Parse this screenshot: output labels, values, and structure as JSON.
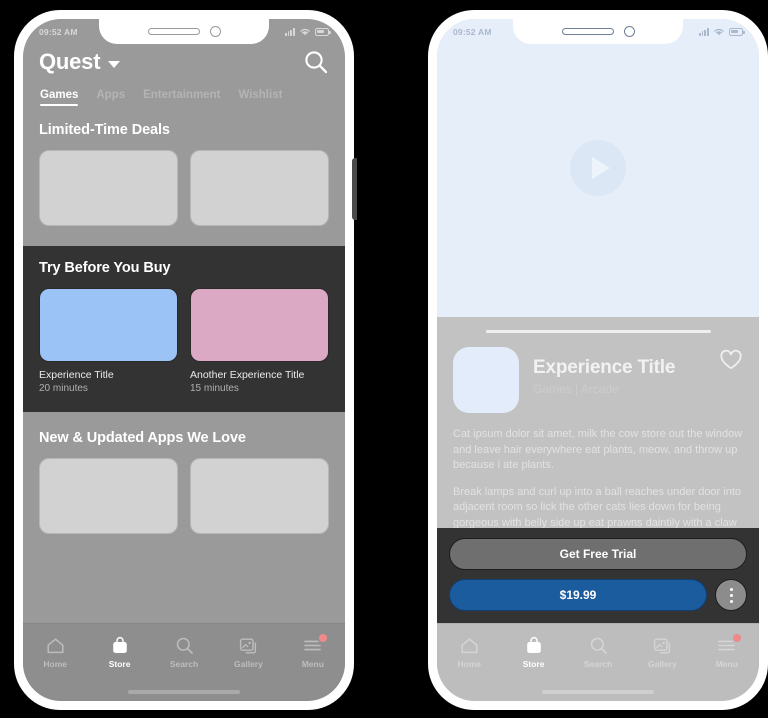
{
  "left_phone": {
    "status_bar": {
      "time": "09:52 AM",
      "icons": [
        "signal-icon",
        "wifi-icon",
        "battery-icon"
      ]
    },
    "header": {
      "brand": "Quest",
      "brand_chevron_icon": "chevron-down-icon",
      "search_icon": "search-icon"
    },
    "tabs": [
      {
        "label": "Games",
        "active": true
      },
      {
        "label": "Apps",
        "active": false
      },
      {
        "label": "Entertainment",
        "active": false
      },
      {
        "label": "Wishlist",
        "active": false
      }
    ],
    "sections": [
      {
        "title": "Limited-Time Deals",
        "placeholders": 2
      },
      {
        "title": "New & Updated Apps We Love",
        "placeholders": 2
      }
    ],
    "try_before_you_buy": {
      "title": "Try Before You Buy",
      "items": [
        {
          "name": "Experience Title",
          "duration": "20 minutes",
          "color": "#9cc3f5"
        },
        {
          "name": "Another Experience Title",
          "duration": "15 minutes",
          "color": "#dba9c4"
        }
      ]
    }
  },
  "right_phone": {
    "status_bar": {
      "time": "09:52 AM",
      "icons": [
        "signal-icon",
        "wifi-icon",
        "battery-icon"
      ]
    },
    "video": {
      "play_icon": "play-icon"
    },
    "detail": {
      "app_title": "Experience Title",
      "app_subtitle": "Games | Arcade",
      "favorite_icon": "heart-icon",
      "paragraphs": [
        "Cat ipsum dolor sit amet, milk the cow store out the window and leave hair everywhere eat plants, meow, and throw up because i ate plants.",
        "Break lamps and curl up into a ball reaches under door into adjacent room so lick the other cats lies down for being gorgeous with belly side up eat prawns daintily with a claw then lick paw wash down prawns with a lap"
      ]
    },
    "actions": {
      "trial_label": "Get Free Trial",
      "price_label": "$19.99",
      "more_icon": "more-vertical-icon"
    }
  },
  "bottom_nav": {
    "items": [
      {
        "label": "Home",
        "icon": "home-icon",
        "active": false,
        "badge": false
      },
      {
        "label": "Store",
        "icon": "store-bag-icon",
        "active": true,
        "badge": false
      },
      {
        "label": "Search",
        "icon": "search-icon",
        "active": false,
        "badge": false
      },
      {
        "label": "Gallery",
        "icon": "gallery-icon",
        "active": false,
        "badge": false
      },
      {
        "label": "Menu",
        "icon": "menu-hamburger-icon",
        "active": false,
        "badge": true
      }
    ]
  },
  "colors": {
    "accent_blue": "#1a5c9e",
    "card_blue": "#9cc3f5",
    "card_pink": "#dba9c4",
    "badge_red": "#f08a8a",
    "dark_band": "#333333"
  }
}
